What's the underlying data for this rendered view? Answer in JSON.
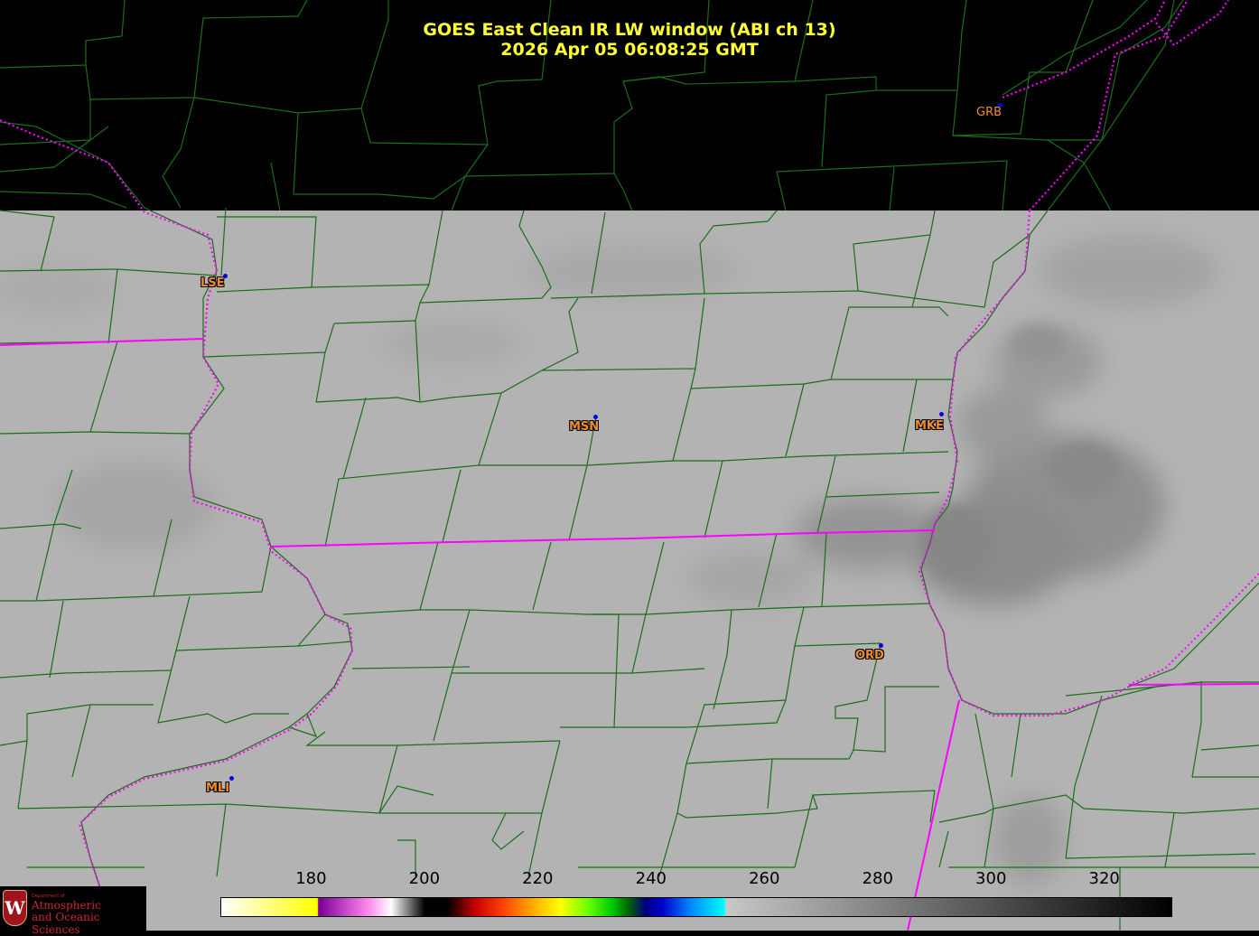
{
  "title": {
    "line1": "GOES East Clean IR LW window (ABI ch 13)",
    "line2": "2026 Apr 05  06:08:25 GMT"
  },
  "cities": [
    {
      "id": "grb",
      "label": "GRB"
    },
    {
      "id": "lse",
      "label": "LSE"
    },
    {
      "id": "msn",
      "label": "MSN"
    },
    {
      "id": "mke",
      "label": "MKE"
    },
    {
      "id": "ord",
      "label": "ORD"
    },
    {
      "id": "mli",
      "label": "MLI"
    }
  ],
  "colorbar": {
    "ticks": [
      "180",
      "200",
      "220",
      "240",
      "260",
      "280",
      "300",
      "320"
    ],
    "range": [
      164,
      332
    ],
    "stops": [
      {
        "v": 164,
        "c": "#ffffff"
      },
      {
        "v": 181,
        "c": "#ffff00"
      },
      {
        "v": 181.2,
        "c": "#7a0096"
      },
      {
        "v": 190,
        "c": "#ff88ee"
      },
      {
        "v": 194,
        "c": "#ffffff"
      },
      {
        "v": 200,
        "c": "#000000"
      },
      {
        "v": 204,
        "c": "#000000"
      },
      {
        "v": 209,
        "c": "#cc0000"
      },
      {
        "v": 214,
        "c": "#ff4400"
      },
      {
        "v": 219,
        "c": "#ffaa00"
      },
      {
        "v": 224,
        "c": "#ffff00"
      },
      {
        "v": 229,
        "c": "#66ff00"
      },
      {
        "v": 233,
        "c": "#00cc00"
      },
      {
        "v": 236,
        "c": "#006600"
      },
      {
        "v": 239,
        "c": "#000080"
      },
      {
        "v": 242,
        "c": "#0000cc"
      },
      {
        "v": 247,
        "c": "#0088ff"
      },
      {
        "v": 253,
        "c": "#00ffff"
      },
      {
        "v": 253.2,
        "c": "#c8c8c8"
      },
      {
        "v": 332,
        "c": "#000000"
      }
    ]
  },
  "colors": {
    "county_lines": "#1a6e1a",
    "state_lines": "#ff00ff",
    "cold_cloud": "#000000",
    "surface": "#b3b3b3",
    "title": "#ffff33",
    "city_label": "#f08c28",
    "station_dot": "#0000e6"
  },
  "logo": {
    "department": "Department of",
    "line1": "Atmospheric",
    "line2": "and Oceanic Sciences",
    "seal": "W"
  }
}
